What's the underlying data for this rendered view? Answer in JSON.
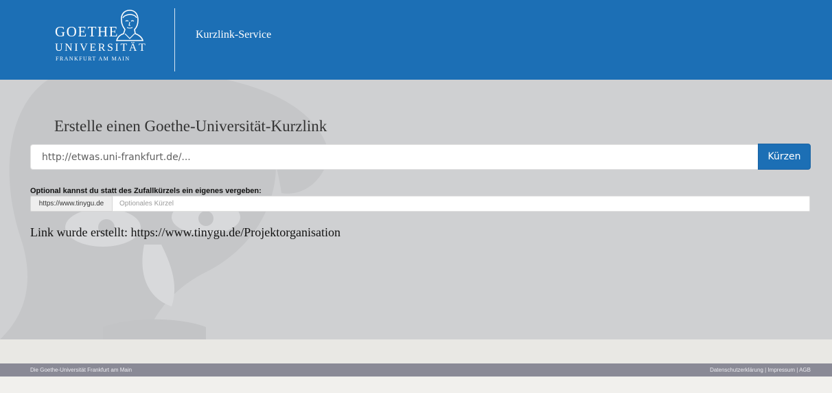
{
  "header": {
    "logo": {
      "line1": "GOETHE",
      "line2": "UNIVERSITÄT",
      "line3": "FRANKFURT AM MAIN"
    },
    "service_title": "Kurzlink-Service"
  },
  "main": {
    "headline": "Erstelle einen Goethe-Universität-Kurzlink",
    "url_input": {
      "placeholder": "http://etwas.uni-frankfurt.de/...",
      "value": ""
    },
    "shorten_button": "Kürzen",
    "optional_label": "Optional kannst du statt des Zufallkürzels ein eigenes vergeben:",
    "alias_prefix": "https://www.tinygu.de",
    "alias_input": {
      "placeholder": "Optionales Kürzel",
      "value": ""
    },
    "result_message": "Link wurde erstellt: https://www.tinygu.de/Projektorganisation"
  },
  "footer": {
    "left_text": "Die Goethe-Universität Frankfurt am Main",
    "links": {
      "privacy": "Datenschutzerklärung",
      "imprint": "Impressum",
      "terms": "AGB"
    },
    "separator": " | "
  },
  "colors": {
    "header_blue": "#1c6fb5",
    "hero_gray": "#cfd0d2",
    "footer_gray": "#8a8a96"
  },
  "icons": [
    "goethe-portrait-logo-icon",
    "goethe-watermark-icon"
  ]
}
